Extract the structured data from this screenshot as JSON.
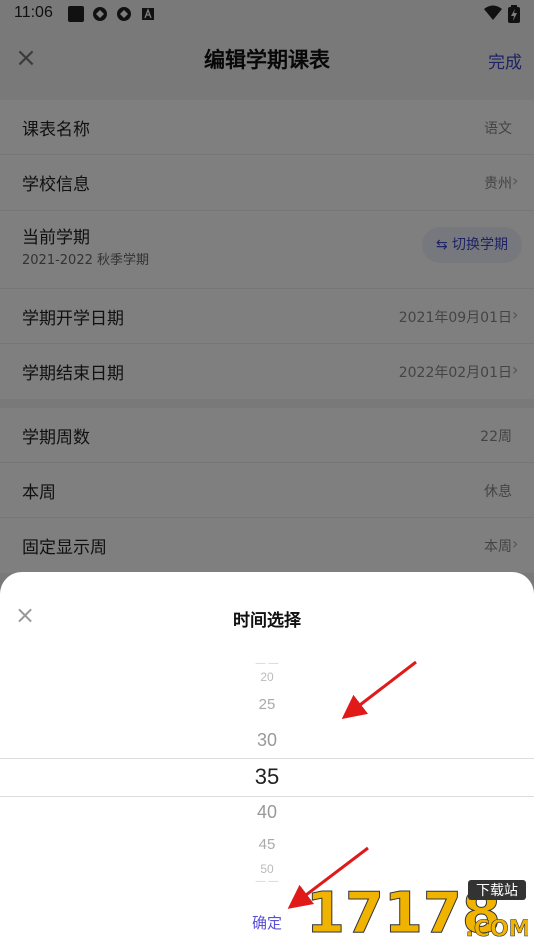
{
  "status_bar": {
    "time": "11:06"
  },
  "header": {
    "title": "编辑学期课表",
    "done_label": "完成"
  },
  "sections": {
    "basic": [
      {
        "label": "课表名称",
        "value": "语文"
      },
      {
        "label": "学校信息",
        "value": "贵州"
      }
    ],
    "term": {
      "label": "当前学期",
      "sub": "2021-2022 秋季学期",
      "switch_label": "切换学期"
    },
    "dates": [
      {
        "label": "学期开学日期",
        "value": "2021年09月01日"
      },
      {
        "label": "学期结束日期",
        "value": "2022年02月01日"
      }
    ],
    "weeks": [
      {
        "label": "学期周数",
        "value": "22周"
      },
      {
        "label": "本周",
        "value": "休息"
      },
      {
        "label": "固定显示周",
        "value": "本周"
      }
    ]
  },
  "sheet": {
    "title": "时间选择",
    "options": [
      "20",
      "25",
      "30",
      "35",
      "40",
      "45",
      "50"
    ],
    "selected": "35",
    "confirm_label": "确定"
  },
  "watermark": {
    "text": "17178",
    "sub": "下载站",
    "domain": ".COM"
  }
}
